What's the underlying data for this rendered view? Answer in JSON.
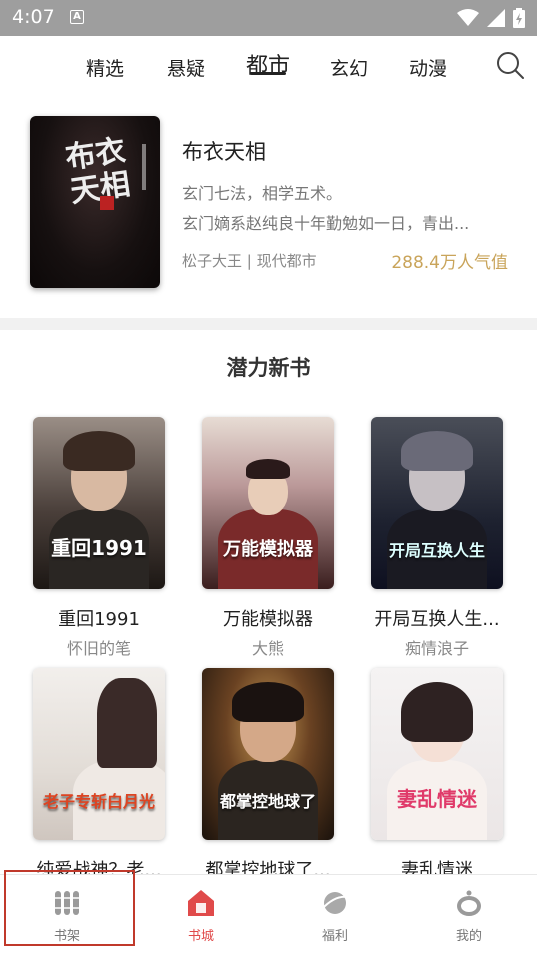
{
  "status_bar": {
    "time": "4:07",
    "a_badge": "A"
  },
  "top_tabs": [
    {
      "label": "精选",
      "active": false
    },
    {
      "label": "悬疑",
      "active": false
    },
    {
      "label": "都市",
      "active": true
    },
    {
      "label": "玄幻",
      "active": false
    },
    {
      "label": "动漫",
      "active": false
    }
  ],
  "featured": {
    "cover_calligraphy": "布衣天相",
    "title": "布衣天相",
    "line1": "玄门七法，相学五术。",
    "line2": "玄门嫡系赵纯良十年勤勉如一日，青出...",
    "meta": "松子大王 | 现代都市",
    "popularity": "288.4万人气值"
  },
  "section": {
    "title": "潜力新书"
  },
  "books": [
    {
      "title": "重回1991",
      "author": "怀旧的笔",
      "cover_text": "重回1991"
    },
    {
      "title": "万能模拟器",
      "author": "大熊",
      "cover_text": "万能模拟器"
    },
    {
      "title": "开局互换人生...",
      "author": "痴情浪子",
      "cover_text": "开局互换人生"
    },
    {
      "title": "纯爱战神？老...",
      "author": "",
      "cover_text": "老子专斩白月光"
    },
    {
      "title": "都掌控地球了...",
      "author": "",
      "cover_text": "都掌控地球了"
    },
    {
      "title": "妻乱情迷",
      "author": "",
      "cover_text": "妻乱情迷"
    }
  ],
  "bottom_nav": [
    {
      "label": "书架",
      "icon": "bookshelf-icon",
      "active": false
    },
    {
      "label": "书城",
      "icon": "bookstore-icon",
      "active": true
    },
    {
      "label": "福利",
      "icon": "planet-icon",
      "active": false
    },
    {
      "label": "我的",
      "icon": "profile-icon",
      "active": false
    }
  ],
  "colors": {
    "accent": "#e04a4a",
    "popularity": "#c9a45a"
  }
}
